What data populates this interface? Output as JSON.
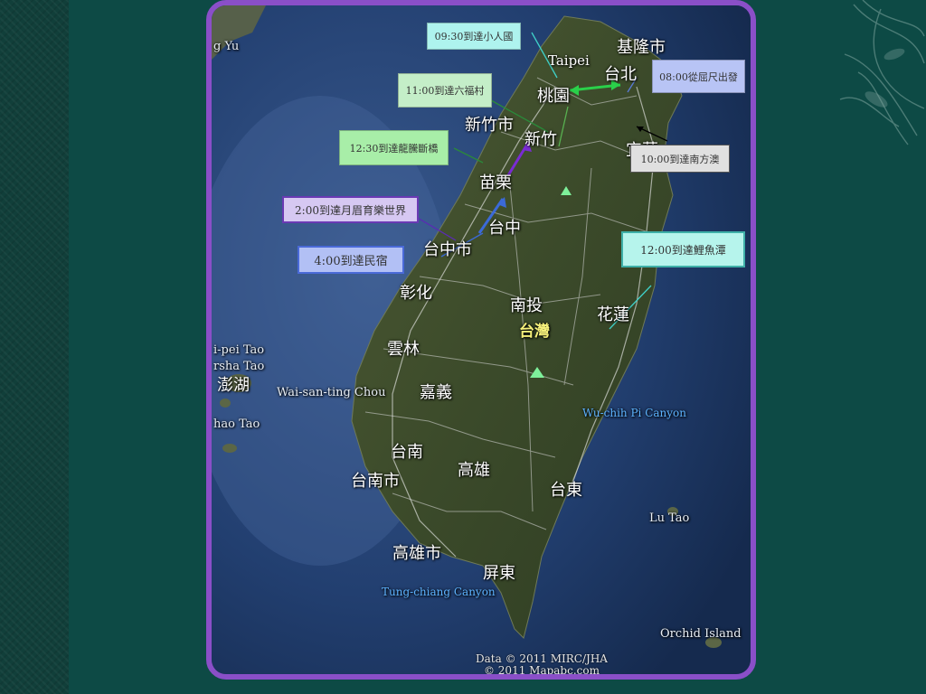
{
  "places": {
    "keelung_city": "基隆市",
    "taipei_en": "Taipei",
    "taipei": "台北",
    "taoyuan": "桃園",
    "hsinchu_city": "新竹市",
    "hsinchu": "新竹",
    "yilan": "宜蘭",
    "miaoli": "苗栗",
    "taichung": "台中",
    "taichung_city": "台中市",
    "changhua": "彰化",
    "nantou": "南投",
    "taiwan": "台灣",
    "hualien": "花蓮",
    "yunlin": "雲林",
    "chiayi": "嘉義",
    "tainan": "台南",
    "tainan_city": "台南市",
    "kaohsiung": "高雄",
    "kaohsiung_city": "高雄市",
    "taitung": "台東",
    "pingtung": "屏東",
    "penghu": "澎湖",
    "ma_tsu_en": "g Yu",
    "pei_tao_en": "i-pei Tao",
    "sha_tao_en": "rsha Tao",
    "hao_tao_en": "hao Tao",
    "waisan_en": "Wai-san-ting Chou",
    "wuchih_en": "Wu-chih Pi Canyon",
    "lutao_en": "Lu Tao",
    "tungchiang_en": "Tung-chiang Canyon",
    "orchid_en": "Orchid Island"
  },
  "callouts": {
    "c0930": "09:30到達小人國",
    "c0800": "08:00從屈尺出發",
    "c1100": "11:00到達六福村",
    "c1000": "10:00到達南方澳",
    "c1230": "12:30到達龍騰斷橋",
    "c0200": "2:00到達月眉育樂世界",
    "c1200": "12:00到達鯉魚潭",
    "c0400": "4:00到達民宿"
  },
  "credit": {
    "line1": "Data © 2011 MIRC/JHA",
    "line2": "© 2011 Mapabc.com"
  },
  "colors": {
    "frame": "#8a4fc8",
    "background": "#0d4a45",
    "callout_cyan": "#aef3ee",
    "callout_blue": "#b8c4f5",
    "callout_green": "#c4eec8",
    "callout_grey": "#e0e0e0",
    "callout_light_green": "#a8eea8",
    "callout_purple": "#d6c8f2",
    "callout_aqua": "#b6f4ec",
    "callout_periwinkle": "#b2c0f5"
  }
}
